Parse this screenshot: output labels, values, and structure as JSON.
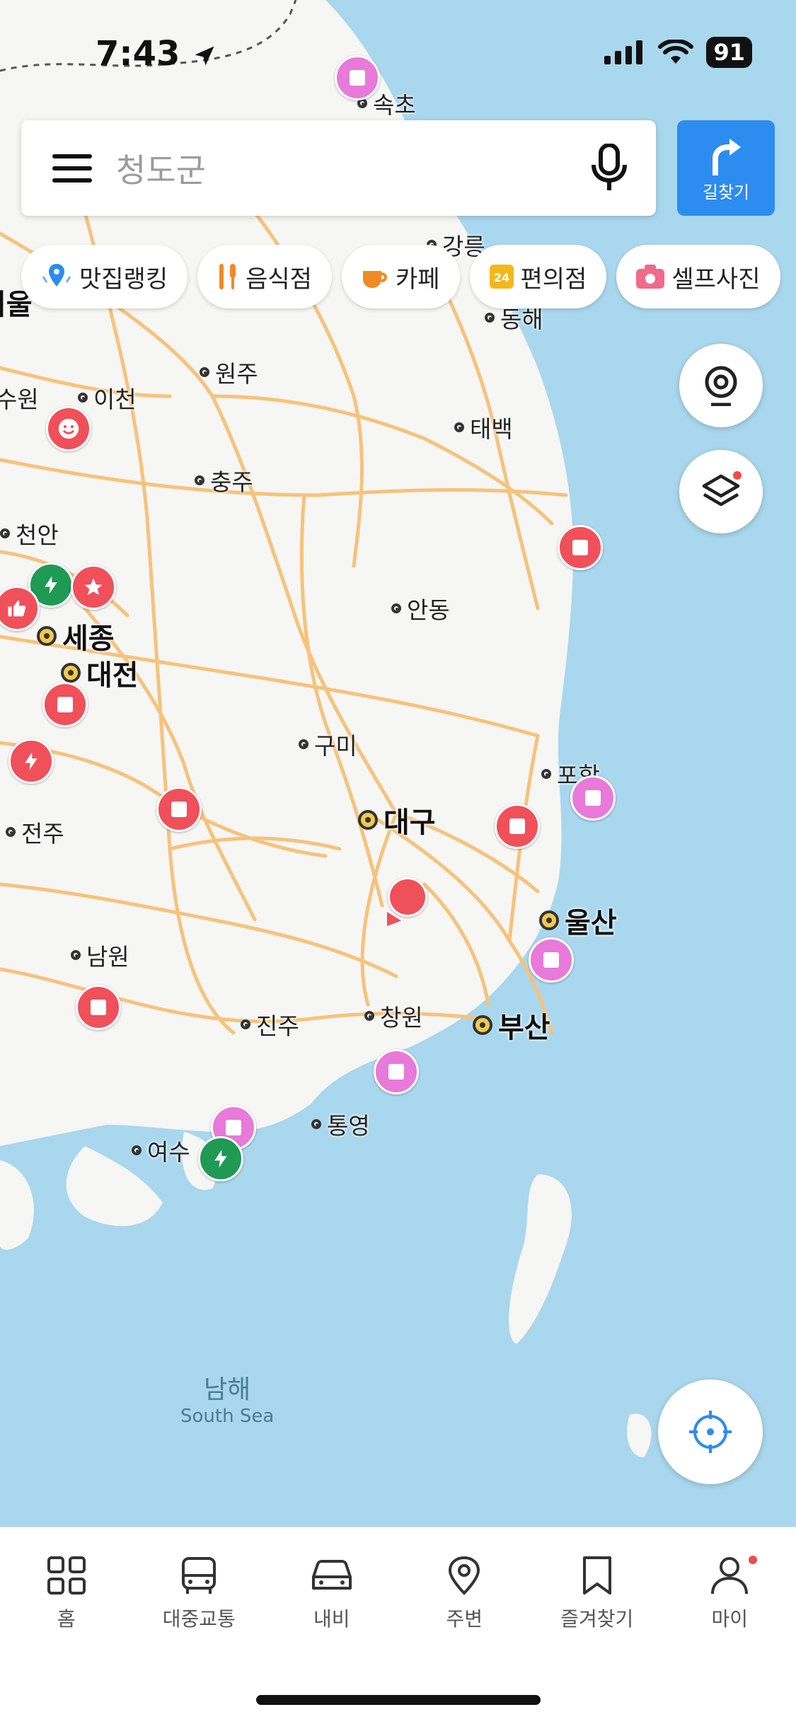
{
  "status_bar": {
    "time": "7:43",
    "battery": "91"
  },
  "search": {
    "placeholder": "청도군"
  },
  "route_button": {
    "label": "길찾기"
  },
  "chips": [
    {
      "label": "맛집랭킹",
      "icon": "ranking-pin-icon"
    },
    {
      "label": "음식점",
      "icon": "utensils-icon"
    },
    {
      "label": "카페",
      "icon": "coffee-cup-icon"
    },
    {
      "label": "편의점",
      "icon": "convenience-24-icon"
    },
    {
      "label": "셀프사진",
      "icon": "camera-icon"
    }
  ],
  "map": {
    "cities": {
      "sokcho": "속초",
      "gangneung": "강릉",
      "donghae": "동해",
      "seoul": "서울",
      "wonju": "원주",
      "suwon": "수원",
      "icheon": "이천",
      "taebaek": "태백",
      "chungju": "충주",
      "cheonan": "천안",
      "andong": "안동",
      "sejong": "세종",
      "daejeon": "대전",
      "gumi": "구미",
      "pohang": "포항",
      "daegu": "대구",
      "jeonju": "전주",
      "ulsan": "울산",
      "namwon": "남원",
      "jinju": "진주",
      "changwon": "창원",
      "busan": "부산",
      "tongyeong": "통영",
      "yeosu": "여수"
    },
    "sea_label_ko": "남해",
    "sea_label_en": "South Sea"
  },
  "bottom_nav": [
    {
      "label": "홈",
      "icon": "grid-icon"
    },
    {
      "label": "대중교통",
      "icon": "bus-icon"
    },
    {
      "label": "내비",
      "icon": "car-icon"
    },
    {
      "label": "주변",
      "icon": "location-pin-icon"
    },
    {
      "label": "즐겨찾기",
      "icon": "bookmark-icon"
    },
    {
      "label": "마이",
      "icon": "person-icon"
    }
  ],
  "colors": {
    "accent": "#2d8cf0",
    "sea": "#a9d7ee",
    "land": "#f6f6f4",
    "road": "#f7c27a",
    "marker_red": "#f0505a",
    "marker_pink": "#e87ad9",
    "marker_green": "#1e9a54"
  }
}
